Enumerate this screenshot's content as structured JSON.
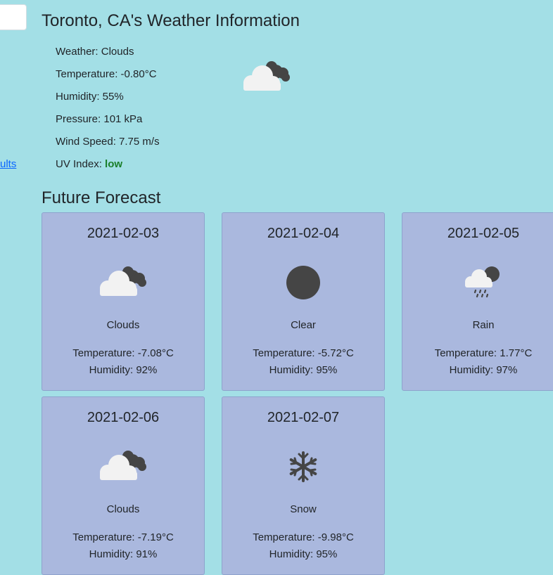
{
  "search": {
    "results_link": "ults"
  },
  "header": {
    "title": "Toronto, CA's Weather Information"
  },
  "current": {
    "icon": "clouds-icon",
    "rows": [
      {
        "label": "Weather: Clouds"
      },
      {
        "label": "Temperature: -0.80°C"
      },
      {
        "label": "Humidity: 55%"
      },
      {
        "label": "Pressure: 101 kPa"
      },
      {
        "label": "Wind Speed: 7.75 m/s"
      }
    ],
    "uv_label": "UV Index: ",
    "uv_value": "low",
    "uv_color": "#1a7f2a"
  },
  "forecast": {
    "title": "Future Forecast",
    "days": [
      {
        "date": "2021-02-03",
        "icon": "clouds-icon",
        "condition": "Clouds",
        "temperature": "Temperature: -7.08°C",
        "humidity": "Humidity: 92%"
      },
      {
        "date": "2021-02-04",
        "icon": "clear-icon",
        "condition": "Clear",
        "temperature": "Temperature: -5.72°C",
        "humidity": "Humidity: 95%"
      },
      {
        "date": "2021-02-05",
        "icon": "rain-icon",
        "condition": "Rain",
        "temperature": "Temperature: 1.77°C",
        "humidity": "Humidity: 97%"
      },
      {
        "date": "2021-02-06",
        "icon": "clouds-icon",
        "condition": "Clouds",
        "temperature": "Temperature: -7.19°C",
        "humidity": "Humidity: 91%"
      },
      {
        "date": "2021-02-07",
        "icon": "snow-icon",
        "condition": "Snow",
        "temperature": "Temperature: -9.98°C",
        "humidity": "Humidity: 95%"
      }
    ]
  },
  "colors": {
    "background": "#a3dfe6",
    "card": "#aab8de",
    "card_border": "#8ea3cd",
    "icon_dark": "#454545",
    "icon_light": "#f2f2f2",
    "link": "#0b67ff"
  }
}
